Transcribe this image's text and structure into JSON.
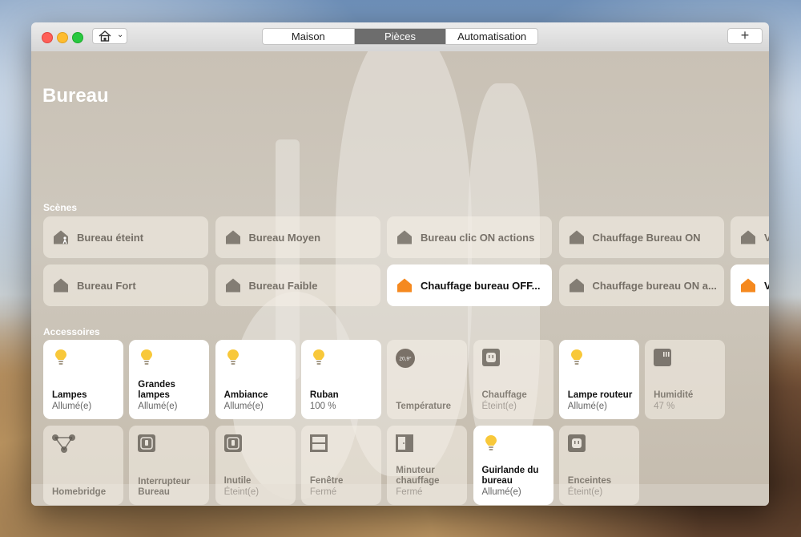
{
  "toolbar": {
    "tabs": [
      {
        "label": "Maison",
        "active": false
      },
      {
        "label": "Pièces",
        "active": true
      },
      {
        "label": "Automatisation",
        "active": false
      }
    ],
    "add_label": "+"
  },
  "room": {
    "title": "Bureau"
  },
  "scenes": {
    "label": "Scènes",
    "items": [
      {
        "label": "Bureau éteint",
        "on": false,
        "icon": "house-person-icon"
      },
      {
        "label": "Bureau Moyen",
        "on": false,
        "icon": "house-icon"
      },
      {
        "label": "Bureau clic ON actions",
        "on": false,
        "icon": "house-icon"
      },
      {
        "label": "Chauffage Bureau ON",
        "on": false,
        "icon": "house-icon"
      },
      {
        "label": "V",
        "on": false,
        "icon": "house-icon"
      },
      {
        "label": "Bureau Fort",
        "on": false,
        "icon": "house-icon"
      },
      {
        "label": "Bureau Faible",
        "on": false,
        "icon": "house-icon"
      },
      {
        "label": "Chauffage bureau OFF...",
        "on": true,
        "icon": "house-icon"
      },
      {
        "label": "Chauffage bureau ON a...",
        "on": false,
        "icon": "house-icon"
      },
      {
        "label": "V",
        "on": true,
        "icon": "house-icon"
      }
    ]
  },
  "accessories": {
    "label": "Accessoires",
    "items": [
      {
        "name": "Lampes",
        "status": "Allumé(e)",
        "on": true,
        "icon": "lightbulb-icon"
      },
      {
        "name": "Grandes lampes",
        "status": "Allumé(e)",
        "on": true,
        "icon": "lightbulb-icon"
      },
      {
        "name": "Ambiance",
        "status": "Allumé(e)",
        "on": true,
        "icon": "lightbulb-icon"
      },
      {
        "name": "Ruban",
        "status": "100 %",
        "on": true,
        "icon": "lightbulb-icon"
      },
      {
        "name": "Température",
        "status": "",
        "on": false,
        "icon": "temperature-icon",
        "icon_text": "20,9°"
      },
      {
        "name": "Chauffage",
        "status": "Éteint(e)",
        "on": false,
        "icon": "outlet-icon"
      },
      {
        "name": "Lampe routeur",
        "status": "Allumé(e)",
        "on": true,
        "icon": "lightbulb-icon"
      },
      {
        "name": "Humidité",
        "status": "47 %",
        "on": false,
        "icon": "humidity-icon"
      },
      {
        "name": "Homebridge",
        "status": "",
        "on": false,
        "icon": "bridge-icon"
      },
      {
        "name": "Interrupteur Bureau",
        "status": "",
        "on": false,
        "icon": "switch-icon"
      },
      {
        "name": "Inutile",
        "status": "Éteint(e)",
        "on": false,
        "icon": "switch-icon"
      },
      {
        "name": "Fenêtre",
        "status": "Fermé",
        "on": false,
        "icon": "window-icon"
      },
      {
        "name": "Minuteur chauffage",
        "status": "Fermé",
        "on": false,
        "icon": "door-icon"
      },
      {
        "name": "Guirlande du bureau",
        "status": "Allumé(e)",
        "on": true,
        "icon": "lightbulb-icon"
      },
      {
        "name": "Enceintes",
        "status": "Éteint(e)",
        "on": false,
        "icon": "outlet-icon"
      }
    ]
  },
  "colors": {
    "accent_orange": "#f5891f",
    "bulb_yellow": "#f8c83a",
    "active_tab": "#6d6d6d"
  }
}
